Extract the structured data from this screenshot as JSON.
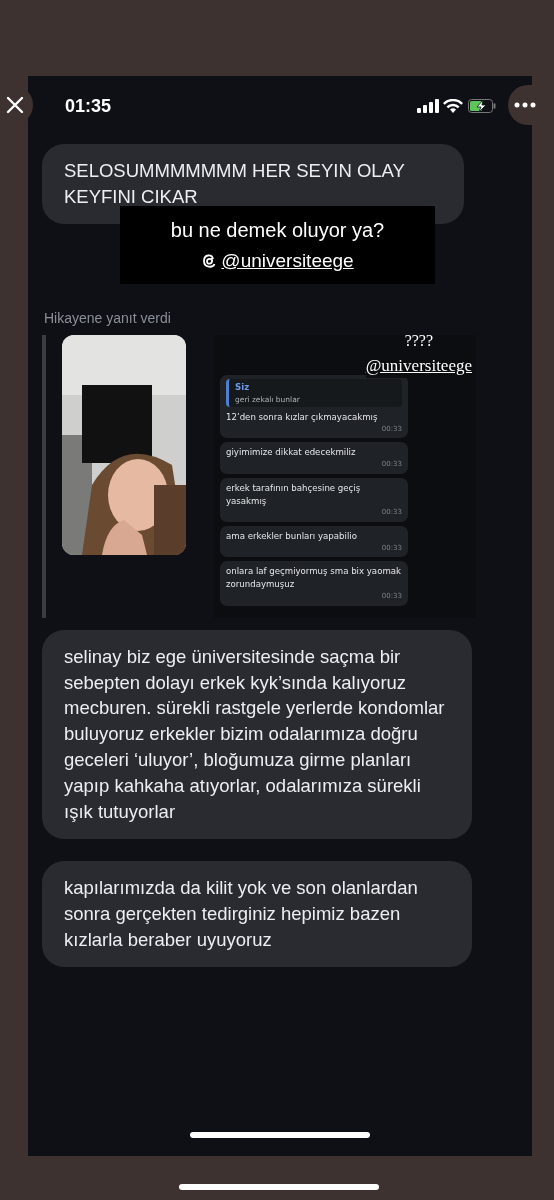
{
  "status_bar": {
    "time": "01:35",
    "battery_charging": true
  },
  "messages": [
    {
      "kind": "text",
      "text": "SELOSUMMMMMMM HER SEYIN OLAY KEYFINI CIKAR"
    },
    {
      "kind": "story_reply",
      "label": "Hikayene yanıt verdi",
      "screenshot": {
        "reply": {
          "author": "Siz",
          "text": "geri zekalı bunlar"
        },
        "chat": [
          {
            "text": "12’den sonra kızlar çıkmayacakmış",
            "time": "00:33"
          },
          {
            "text": "giyimimize dikkat edecekmiliz",
            "time": "00:33"
          },
          {
            "text": "erkek tarafının bahçesine geçiş yasakmış",
            "time": "00:33"
          },
          {
            "text": "ama erkekler bunları yapabilio",
            "time": "00:33"
          },
          {
            "text": "onlara laf geçmiyormuş sma bix yaomak zorundaymuşuz",
            "time": "00:33"
          }
        ],
        "overlay": {
          "question": "????",
          "mention": "@universiteege"
        }
      }
    },
    {
      "kind": "text",
      "text": "selinay biz ege üniversitesinde saçma bir sebepten dolayı erkek kyk’sında kalıyoruz mecburen. sürekli rastgele yerlerde kondomlar buluyoruz erkekler bizim odalarımıza doğru geceleri ‘uluyor’, bloğumuza girme planları yapıp kahkaha atıyorlar, odalarımıza sürekli ışık tutuyorlar"
    },
    {
      "kind": "text",
      "text": "kapılarımızda da kilit yok ve son olanlardan sonra gerçekten tedirginiz hepimiz bazen kızlarla beraber uyuyoruz"
    }
  ],
  "sticker": {
    "text": "bu ne demek oluyor ya?",
    "mention": "@universiteege"
  }
}
